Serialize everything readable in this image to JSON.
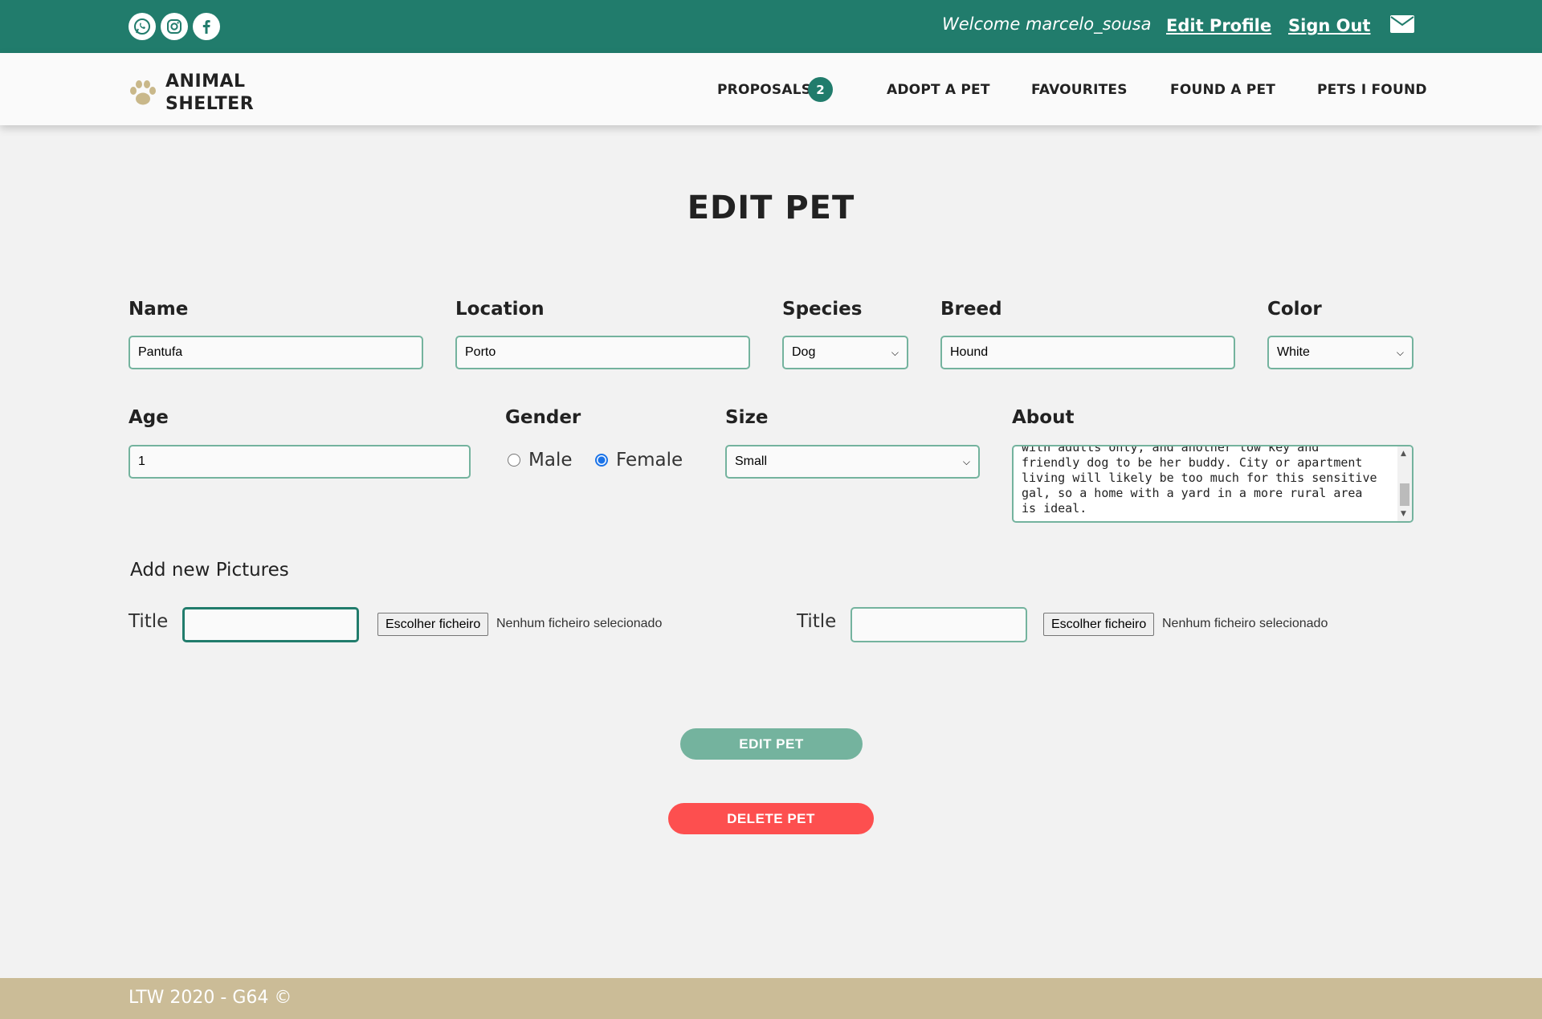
{
  "topbar": {
    "social_icons": [
      "whatsapp-icon",
      "instagram-icon",
      "facebook-icon"
    ],
    "welcome_text": "Welcome marcelo_sousa",
    "edit_profile": "Edit Profile",
    "sign_out": "Sign Out",
    "mail_icon": "mail-icon"
  },
  "nav": {
    "logo_icon": "paw-icon",
    "logo_text": "ANIMAL\nSHELTER",
    "items": [
      "PROPOSALS",
      "ADOPT A PET",
      "FAVOURITES",
      "FOUND A PET",
      "PETS I FOUND"
    ],
    "proposals_count": "2"
  },
  "page": {
    "title": "EDIT PET"
  },
  "form": {
    "name": {
      "label": "Name",
      "value": "Pantufa"
    },
    "location": {
      "label": "Location",
      "value": "Porto"
    },
    "species": {
      "label": "Species",
      "value": "Dog"
    },
    "breed": {
      "label": "Breed",
      "value": "Hound"
    },
    "color": {
      "label": "Color",
      "value": "White"
    },
    "age": {
      "label": "Age",
      "value": "1"
    },
    "gender": {
      "label": "Gender",
      "options": [
        "Male",
        "Female"
      ],
      "selected": "Female"
    },
    "size": {
      "label": "Size",
      "value": "Small"
    },
    "about": {
      "label": "About",
      "visible_text": "with adults only, and another low key and\nfriendly dog to be her buddy. City or apartment\nliving will likely be too much for this sensitive\ngal, so a home with a yard in a more rural area\nis ideal."
    }
  },
  "pictures": {
    "heading": "Add new Pictures",
    "title_label": "Title",
    "file_button": "Escolher ficheiro",
    "no_file": "Nenhum ficheiro selecionado"
  },
  "actions": {
    "edit": "EDIT PET",
    "delete": "DELETE PET"
  },
  "footer": {
    "text": "LTW 2020 - G64 ©"
  },
  "colors": {
    "primary": "#217c6c",
    "accent_light": "#74b39e",
    "danger": "#fd4f4f",
    "footer": "#cbbc97",
    "logo_paw": "#c9b88a"
  }
}
